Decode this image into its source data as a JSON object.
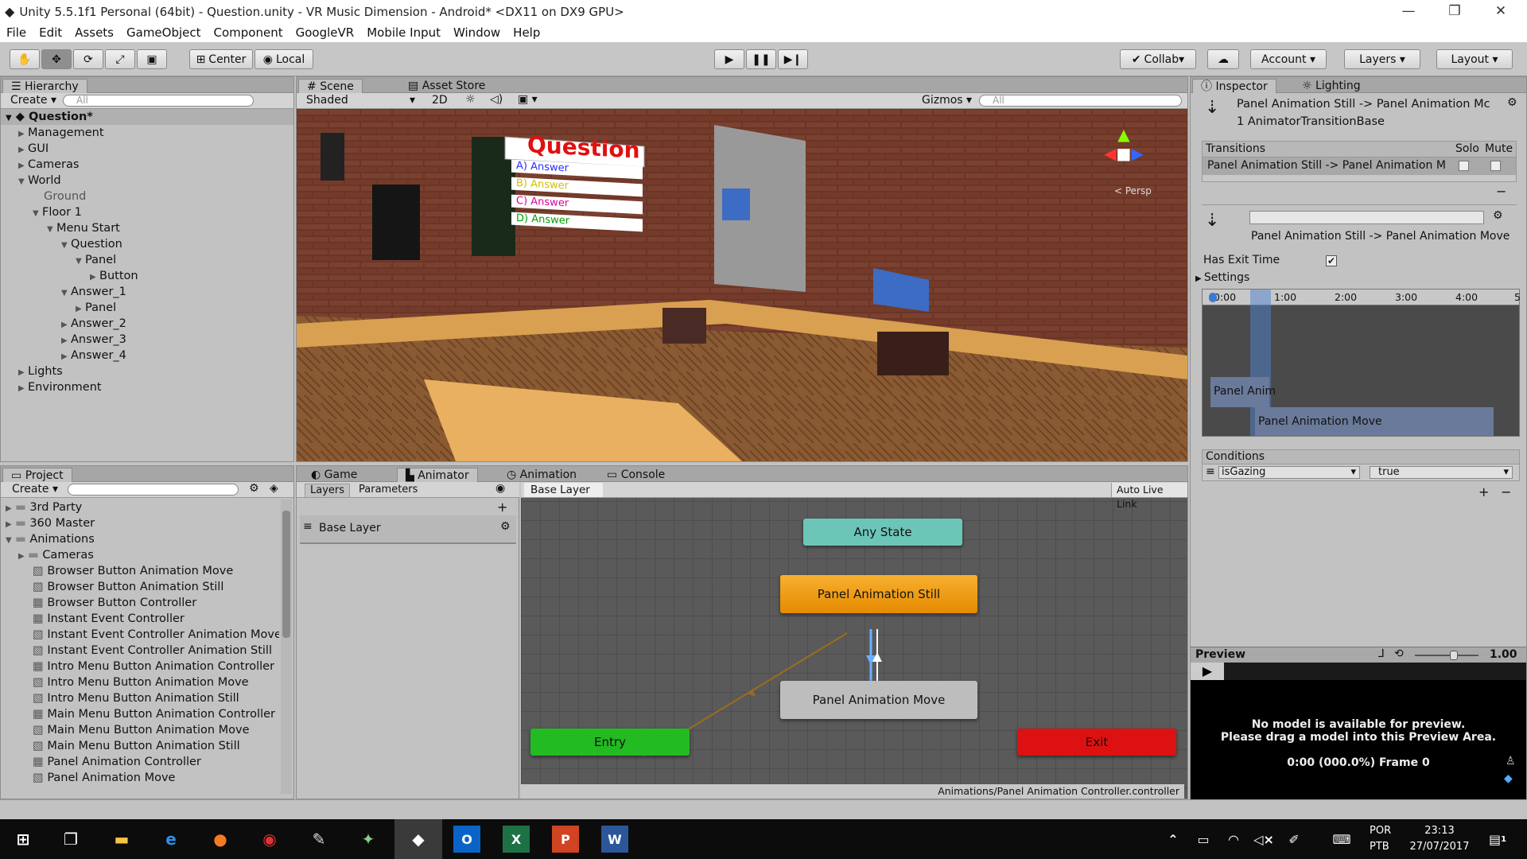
{
  "window": {
    "title": "Unity 5.5.1f1 Personal (64bit) - Question.unity - VR Music Dimension - Android* <DX11 on DX9 GPU>"
  },
  "menu": [
    "File",
    "Edit",
    "Assets",
    "GameObject",
    "Component",
    "GoogleVR",
    "Mobile Input",
    "Window",
    "Help"
  ],
  "toolbar": {
    "center": "Center",
    "local": "Local",
    "collab": "Collab",
    "account": "Account",
    "layers": "Layers",
    "layout": "Layout"
  },
  "hierarchy": {
    "tab": "Hierarchy",
    "create": "Create",
    "search": "All",
    "scene": "Question*",
    "items": [
      "Management",
      "GUI",
      "Cameras",
      "World",
      "Ground",
      "Floor 1",
      "Menu Start",
      "Question",
      "Panel",
      "Button",
      "Answer_1",
      "Panel",
      "Answer_2",
      "Answer_3",
      "Answer_4",
      "Lights",
      "Environment"
    ]
  },
  "scene": {
    "tabs": [
      "Scene",
      "Asset Store"
    ],
    "shaded": "Shaded",
    "mode2d": "2D",
    "gizmos": "Gizmos",
    "search": "All",
    "sign": {
      "title": "Question",
      "answers": [
        "A) Answer",
        "B) Answer",
        "C) Answer",
        "D) Answer"
      ],
      "answer_colors": [
        "#2a2aff",
        "#e0e000",
        "#e000a0",
        "#00c000"
      ]
    },
    "gizmo_label": "< Persp"
  },
  "project": {
    "tab": "Project",
    "create": "Create",
    "items": [
      "3rd Party",
      "360 Master",
      "Animations",
      "Cameras",
      "Browser Button Animation Move",
      "Browser Button Animation Still",
      "Browser Button Controller",
      "Instant Event Controller",
      "Instant Event Controller Animation Move",
      "Instant Event Controller Animation Still",
      "Intro Menu Button Animation Controller",
      "Intro Menu Button Animation Move",
      "Intro Menu Button Animation Still",
      "Main Menu Button Animation Controller",
      "Main Menu Button Animation Move",
      "Main Menu Button Animation Still",
      "Panel Animation Controller",
      "Panel Animation Move"
    ]
  },
  "animator": {
    "tabs": [
      "Game",
      "Animator",
      "Animation",
      "Console"
    ],
    "layers_tab": "Layers",
    "params_tab": "Parameters",
    "layer": "Base Layer",
    "breadcrumb": "Base Layer",
    "live_link": "Auto Live Link",
    "states": {
      "any": "Any State",
      "still": "Panel Animation Still",
      "move": "Panel Animation Move",
      "entry": "Entry",
      "exit": "Exit"
    },
    "colors": {
      "any": "#6cc6b8",
      "still": "#f39c12",
      "move": "#bdbdbd",
      "entry": "#22bb22",
      "exit": "#dd1111"
    },
    "path": "Animations/Panel Animation Controller.controller"
  },
  "inspector": {
    "tabs": [
      "Inspector",
      "Lighting"
    ],
    "header_title": "Panel Animation Still -> Panel Animation Mc",
    "header_sub": "1 AnimatorTransitionBase",
    "transitions_label": "Transitions",
    "solo": "Solo",
    "mute": "Mute",
    "transition_item": "Panel Animation Still -> Panel Animation M",
    "transition_name": "Panel Animation Still -> Panel Animation Move",
    "has_exit_time": "Has Exit Time",
    "settings": "Settings",
    "timeline_ticks": [
      "0:00",
      "1:00",
      "2:00",
      "3:00",
      "4:00",
      "5"
    ],
    "clip_a": "Panel Anim",
    "clip_b": "Panel Animation Move",
    "conditions": "Conditions",
    "cond_param": "isGazing",
    "cond_value": "true",
    "preview": "Preview",
    "preview_speed": "1.00",
    "preview_msg1": "No model is available for preview.",
    "preview_msg2": "Please drag a model into this Preview Area.",
    "preview_frame": "0:00 (000.0%) Frame 0"
  },
  "taskbar": {
    "lang1": "POR",
    "lang2": "PTB",
    "time": "23:13",
    "date": "27/07/2017",
    "notif": "1"
  }
}
